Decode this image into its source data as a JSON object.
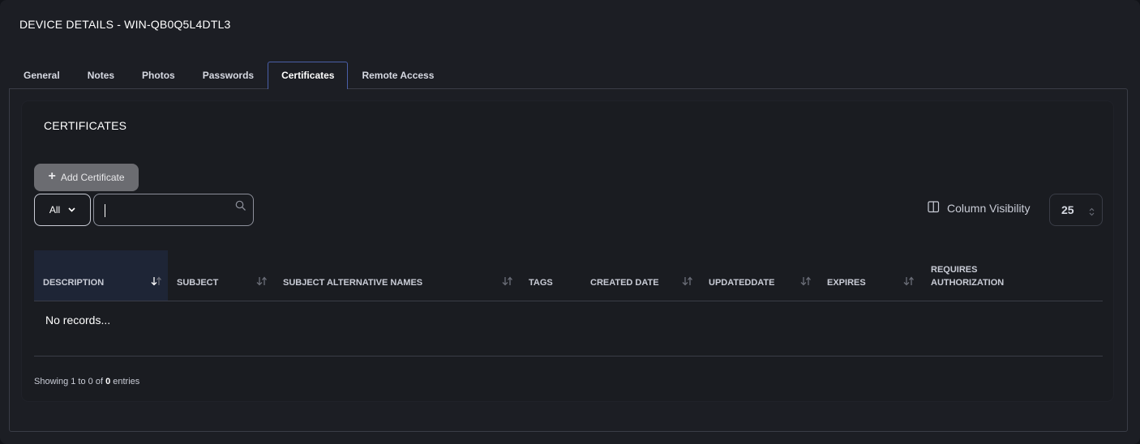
{
  "device": {
    "title": "DEVICE DETAILS - WIN-QB0Q5L4DTL3"
  },
  "tabs": [
    {
      "label": "General",
      "active": false
    },
    {
      "label": "Notes",
      "active": false
    },
    {
      "label": "Photos",
      "active": false
    },
    {
      "label": "Passwords",
      "active": false
    },
    {
      "label": "Certificates",
      "active": true
    },
    {
      "label": "Remote Access",
      "active": false
    }
  ],
  "section": {
    "title": "CERTIFICATES"
  },
  "toolbar": {
    "add_label": "Add Certificate",
    "add_icon": "plus-icon",
    "filter_value": "All",
    "search_value": "",
    "column_visibility_label": "Column Visibility",
    "column_visibility_icon": "columns-icon",
    "page_size": "25"
  },
  "table": {
    "columns": [
      {
        "label": "DESCRIPTION",
        "sortable": true,
        "sorted": true
      },
      {
        "label": "SUBJECT",
        "sortable": true,
        "sorted": false
      },
      {
        "label": "SUBJECT ALTERNATIVE NAMES",
        "sortable": true,
        "sorted": false
      },
      {
        "label": "TAGS",
        "sortable": false,
        "sorted": false
      },
      {
        "label": "CREATED DATE",
        "sortable": true,
        "sorted": false
      },
      {
        "label": "UPDATEDDATE",
        "sortable": true,
        "sorted": false
      },
      {
        "label": "EXPIRES",
        "sortable": true,
        "sorted": false
      },
      {
        "label": "REQUIRES AUTHORIZATION",
        "sortable": false,
        "sorted": false
      }
    ],
    "empty_text": "No records..."
  },
  "footer": {
    "info_prefix": "Showing 1 to 0 of",
    "info_total": "0",
    "info_suffix": "entries"
  },
  "colors": {
    "panel_bg": "#1c1e24",
    "active_tab_border": "#4a5fa8",
    "sorted_header_bg": "#1e2536",
    "add_button_bg": "#6b6c71"
  }
}
